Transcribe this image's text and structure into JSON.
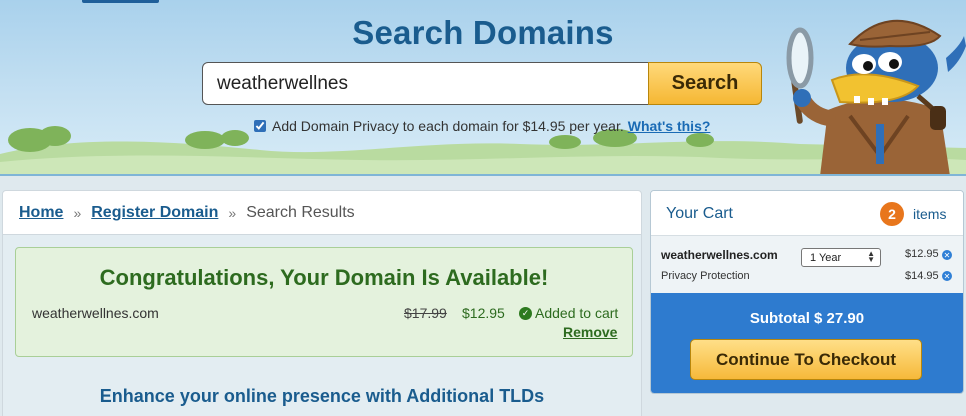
{
  "hero": {
    "title": "Search Domains",
    "search_value": "weatherwellnes",
    "search_button": "Search",
    "privacy_text": "Add Domain Privacy to each domain for $14.95 per year.",
    "privacy_link": "What's this?",
    "privacy_checked": true
  },
  "breadcrumb": {
    "home": "Home",
    "register": "Register Domain",
    "separator": "»",
    "current": "Search Results"
  },
  "availability": {
    "title": "Congratulations, Your Domain Is Available!",
    "domain": "weatherwellnes.com",
    "old_price": "$17.99",
    "new_price": "$12.95",
    "status": "Added to cart",
    "remove": "Remove"
  },
  "enhance_heading": "Enhance your online presence with Additional TLDs",
  "cart": {
    "title": "Your Cart",
    "count": "2",
    "items_label": "items",
    "lines": [
      {
        "name": "weatherwellnes.com",
        "term": "1 Year",
        "price": "$12.95"
      },
      {
        "name": "Privacy Protection",
        "price": "$14.95"
      }
    ],
    "subtotal": "Subtotal $ 27.90",
    "checkout": "Continue To Checkout"
  },
  "colors": {
    "brand_blue": "#1a5c8e",
    "accent_orange": "#e8761c",
    "success_green": "#2d6b1f",
    "cart_blue": "#2e7bcf"
  }
}
